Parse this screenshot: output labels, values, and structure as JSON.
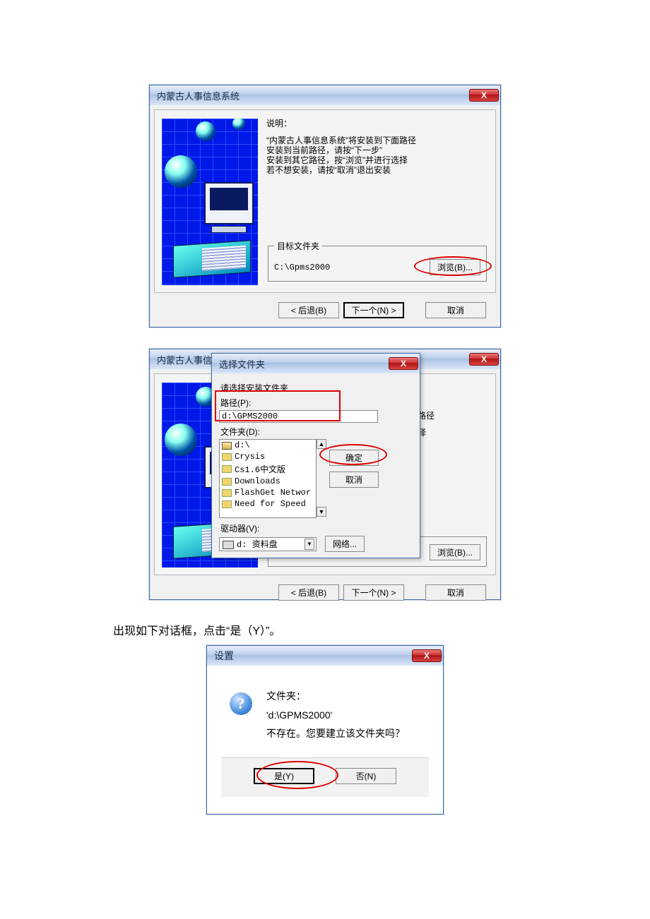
{
  "win1": {
    "title": "内蒙古人事信息系统",
    "close": "X",
    "explain_head": "说明：",
    "explain_l1": "“内蒙古人事信息系统”将安装到下面路径",
    "explain_l2": "安装到当前路径，请按“下一步”",
    "explain_l3": "安装到其它路径，按“浏览”并进行选择",
    "explain_l4": "若不想安装，请按“取消”退出安装",
    "target_legend": "目标文件夹",
    "target_path": "C:\\Gpms2000",
    "browse": "浏览(B)...",
    "back": "< 后退(B)",
    "next": "下一个(N) >",
    "cancel": "取消"
  },
  "win2": {
    "bg_title": "内蒙古人事信",
    "partial_l1": "面路径",
    "partial_l2": "选择",
    "browse": "浏览(B)...",
    "back": "< 后退(B)",
    "next": "下一个(N) >",
    "next_label_variant": "下一个(N) >",
    "cancel": "取消",
    "dlg_title": "选择文件夹",
    "instr": "请选择安装文件夹",
    "path_label": "路径(P):",
    "path_value": "d:\\GPMS2000",
    "folders_label": "文件夹(D):",
    "folder_items": [
      "d:\\",
      "Crysis",
      "Cs1.6中文版",
      "Downloads",
      "FlashGet Networ",
      "Need for Speed"
    ],
    "drive_label": "驱动器(V):",
    "drive_value": "d: 资料盘",
    "ok": "确定",
    "cancel_small": "取消",
    "network": "网络...",
    "close": "X"
  },
  "caption": "出现如下对话框，点击“是（Y）”。",
  "settings": {
    "title": "设置",
    "close": "X",
    "l1": "文件夹：",
    "l2": "'d:\\GPMS2000'",
    "l3": "不存在。您要建立该文件夹吗？",
    "yes": "是(Y)",
    "no": "否(N)"
  }
}
